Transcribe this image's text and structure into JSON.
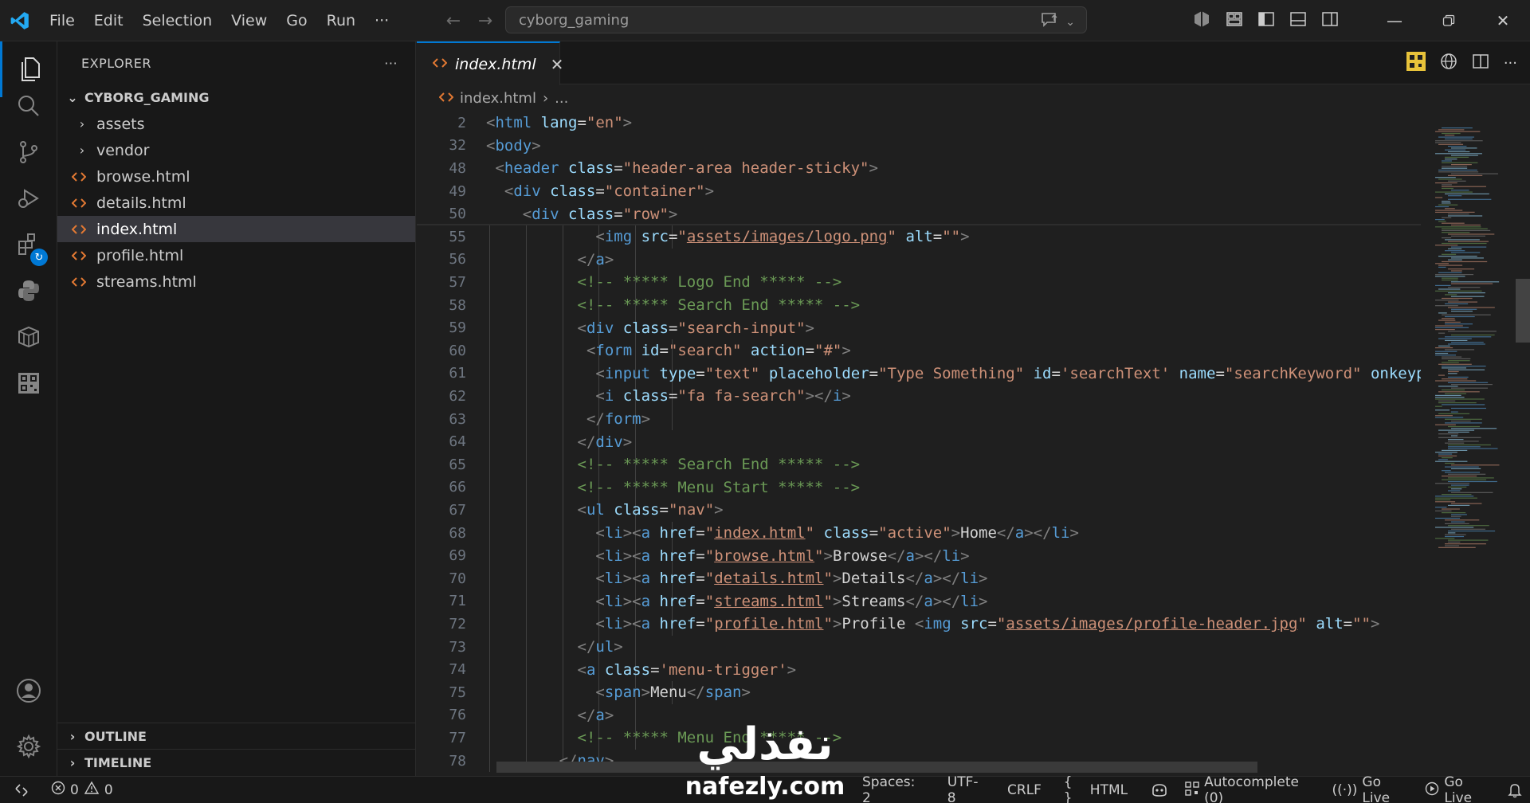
{
  "titlebar": {
    "menu": [
      "File",
      "Edit",
      "Selection",
      "View",
      "Go",
      "Run",
      "···"
    ],
    "search_text": "cyborg_gaming"
  },
  "activity_icons": [
    "explorer-icon",
    "search-icon",
    "source-control-icon",
    "run-debug-icon",
    "extensions-icon",
    "python-icon",
    "containers-icon",
    "qr-icon",
    "accounts-icon",
    "settings-gear-icon"
  ],
  "sidebar": {
    "title": "EXPLORER",
    "more": "···",
    "folder": "CYBORG_GAMING",
    "items": [
      {
        "label": "assets",
        "type": "folder"
      },
      {
        "label": "vendor",
        "type": "folder"
      },
      {
        "label": "browse.html",
        "type": "file"
      },
      {
        "label": "details.html",
        "type": "file"
      },
      {
        "label": "index.html",
        "type": "file",
        "selected": true
      },
      {
        "label": "profile.html",
        "type": "file"
      },
      {
        "label": "streams.html",
        "type": "file"
      }
    ],
    "outline": "OUTLINE",
    "timeline": "TIMELINE"
  },
  "editor": {
    "tab_label": "index.html",
    "breadcrumb_file": "index.html",
    "breadcrumb_rest": "...",
    "lines": [
      {
        "n": "2",
        "indent": 0,
        "tokens": [
          [
            "br",
            "<"
          ],
          [
            "tag",
            "html"
          ],
          [
            "txt",
            " "
          ],
          [
            "attr",
            "lang"
          ],
          [
            "txt",
            "="
          ],
          [
            "str",
            "\"en\""
          ],
          [
            "br",
            ">"
          ]
        ]
      },
      {
        "n": "32",
        "indent": 0,
        "tokens": [
          [
            "br",
            "<"
          ],
          [
            "tag",
            "body"
          ],
          [
            "br",
            ">"
          ]
        ]
      },
      {
        "n": "48",
        "indent": 1,
        "tokens": [
          [
            "br",
            "<"
          ],
          [
            "tag",
            "header"
          ],
          [
            "txt",
            " "
          ],
          [
            "attr",
            "class"
          ],
          [
            "txt",
            "="
          ],
          [
            "str",
            "\"header-area header-sticky\""
          ],
          [
            "br",
            ">"
          ]
        ]
      },
      {
        "n": "49",
        "indent": 2,
        "tokens": [
          [
            "br",
            "<"
          ],
          [
            "tag",
            "div"
          ],
          [
            "txt",
            " "
          ],
          [
            "attr",
            "class"
          ],
          [
            "txt",
            "="
          ],
          [
            "str",
            "\"container\""
          ],
          [
            "br",
            ">"
          ]
        ]
      },
      {
        "n": "50",
        "indent": 4,
        "tokens": [
          [
            "br",
            "<"
          ],
          [
            "tag",
            "div"
          ],
          [
            "txt",
            " "
          ],
          [
            "attr",
            "class"
          ],
          [
            "txt",
            "="
          ],
          [
            "str",
            "\"row\""
          ],
          [
            "br",
            ">"
          ]
        ]
      },
      {
        "n": "55",
        "indent": 12,
        "tokens": [
          [
            "br",
            "<"
          ],
          [
            "tag",
            "img"
          ],
          [
            "txt",
            " "
          ],
          [
            "attr",
            "src"
          ],
          [
            "txt",
            "="
          ],
          [
            "str",
            "\""
          ],
          [
            "link",
            "assets/images/logo.png"
          ],
          [
            "str",
            "\""
          ],
          [
            "txt",
            " "
          ],
          [
            "attr",
            "alt"
          ],
          [
            "txt",
            "="
          ],
          [
            "str",
            "\"\""
          ],
          [
            "br",
            ">"
          ]
        ]
      },
      {
        "n": "56",
        "indent": 10,
        "tokens": [
          [
            "br",
            "</"
          ],
          [
            "tag",
            "a"
          ],
          [
            "br",
            ">"
          ]
        ]
      },
      {
        "n": "57",
        "indent": 10,
        "tokens": [
          [
            "cmt",
            "<!-- ***** Logo End ***** -->"
          ]
        ]
      },
      {
        "n": "58",
        "indent": 10,
        "tokens": [
          [
            "cmt",
            "<!-- ***** Search End ***** -->"
          ]
        ]
      },
      {
        "n": "59",
        "indent": 10,
        "tokens": [
          [
            "br",
            "<"
          ],
          [
            "tag",
            "div"
          ],
          [
            "txt",
            " "
          ],
          [
            "attr",
            "class"
          ],
          [
            "txt",
            "="
          ],
          [
            "str",
            "\"search-input\""
          ],
          [
            "br",
            ">"
          ]
        ]
      },
      {
        "n": "60",
        "indent": 11,
        "tokens": [
          [
            "br",
            "<"
          ],
          [
            "tag",
            "form"
          ],
          [
            "txt",
            " "
          ],
          [
            "attr",
            "id"
          ],
          [
            "txt",
            "="
          ],
          [
            "str",
            "\"search\""
          ],
          [
            "txt",
            " "
          ],
          [
            "attr",
            "action"
          ],
          [
            "txt",
            "="
          ],
          [
            "str",
            "\"#\""
          ],
          [
            "br",
            ">"
          ]
        ]
      },
      {
        "n": "61",
        "indent": 12,
        "tokens": [
          [
            "br",
            "<"
          ],
          [
            "tag",
            "input"
          ],
          [
            "txt",
            " "
          ],
          [
            "attr",
            "type"
          ],
          [
            "txt",
            "="
          ],
          [
            "str",
            "\"text\""
          ],
          [
            "txt",
            " "
          ],
          [
            "attr",
            "placeholder"
          ],
          [
            "txt",
            "="
          ],
          [
            "str",
            "\"Type Something\""
          ],
          [
            "txt",
            " "
          ],
          [
            "attr",
            "id"
          ],
          [
            "txt",
            "="
          ],
          [
            "str",
            "'searchText'"
          ],
          [
            "txt",
            " "
          ],
          [
            "attr",
            "name"
          ],
          [
            "txt",
            "="
          ],
          [
            "str",
            "\"searchKeyword\""
          ],
          [
            "txt",
            " "
          ],
          [
            "attr",
            "onkeypress"
          ]
        ]
      },
      {
        "n": "62",
        "indent": 12,
        "tokens": [
          [
            "br",
            "<"
          ],
          [
            "tag",
            "i"
          ],
          [
            "txt",
            " "
          ],
          [
            "attr",
            "class"
          ],
          [
            "txt",
            "="
          ],
          [
            "str",
            "\"fa fa-search\""
          ],
          [
            "br",
            "></"
          ],
          [
            "tag",
            "i"
          ],
          [
            "br",
            ">"
          ]
        ]
      },
      {
        "n": "63",
        "indent": 11,
        "tokens": [
          [
            "br",
            "</"
          ],
          [
            "tag",
            "form"
          ],
          [
            "br",
            ">"
          ]
        ]
      },
      {
        "n": "64",
        "indent": 10,
        "tokens": [
          [
            "br",
            "</"
          ],
          [
            "tag",
            "div"
          ],
          [
            "br",
            ">"
          ]
        ]
      },
      {
        "n": "65",
        "indent": 10,
        "tokens": [
          [
            "cmt",
            "<!-- ***** Search End ***** -->"
          ]
        ]
      },
      {
        "n": "66",
        "indent": 10,
        "tokens": [
          [
            "cmt",
            "<!-- ***** Menu Start ***** -->"
          ]
        ]
      },
      {
        "n": "67",
        "indent": 10,
        "tokens": [
          [
            "br",
            "<"
          ],
          [
            "tag",
            "ul"
          ],
          [
            "txt",
            " "
          ],
          [
            "attr",
            "class"
          ],
          [
            "txt",
            "="
          ],
          [
            "str",
            "\"nav\""
          ],
          [
            "br",
            ">"
          ]
        ]
      },
      {
        "n": "68",
        "indent": 12,
        "tokens": [
          [
            "br",
            "<"
          ],
          [
            "tag",
            "li"
          ],
          [
            "br",
            "><"
          ],
          [
            "tag",
            "a"
          ],
          [
            "txt",
            " "
          ],
          [
            "attr",
            "href"
          ],
          [
            "txt",
            "="
          ],
          [
            "str",
            "\""
          ],
          [
            "link",
            "index.html"
          ],
          [
            "str",
            "\""
          ],
          [
            "txt",
            " "
          ],
          [
            "attr",
            "class"
          ],
          [
            "txt",
            "="
          ],
          [
            "str",
            "\"active\""
          ],
          [
            "br",
            ">"
          ],
          [
            "txt",
            "Home"
          ],
          [
            "br",
            "</"
          ],
          [
            "tag",
            "a"
          ],
          [
            "br",
            "></"
          ],
          [
            "tag",
            "li"
          ],
          [
            "br",
            ">"
          ]
        ]
      },
      {
        "n": "69",
        "indent": 12,
        "tokens": [
          [
            "br",
            "<"
          ],
          [
            "tag",
            "li"
          ],
          [
            "br",
            "><"
          ],
          [
            "tag",
            "a"
          ],
          [
            "txt",
            " "
          ],
          [
            "attr",
            "href"
          ],
          [
            "txt",
            "="
          ],
          [
            "str",
            "\""
          ],
          [
            "link",
            "browse.html"
          ],
          [
            "str",
            "\""
          ],
          [
            "br",
            ">"
          ],
          [
            "txt",
            "Browse"
          ],
          [
            "br",
            "</"
          ],
          [
            "tag",
            "a"
          ],
          [
            "br",
            "></"
          ],
          [
            "tag",
            "li"
          ],
          [
            "br",
            ">"
          ]
        ]
      },
      {
        "n": "70",
        "indent": 12,
        "tokens": [
          [
            "br",
            "<"
          ],
          [
            "tag",
            "li"
          ],
          [
            "br",
            "><"
          ],
          [
            "tag",
            "a"
          ],
          [
            "txt",
            " "
          ],
          [
            "attr",
            "href"
          ],
          [
            "txt",
            "="
          ],
          [
            "str",
            "\""
          ],
          [
            "link",
            "details.html"
          ],
          [
            "str",
            "\""
          ],
          [
            "br",
            ">"
          ],
          [
            "txt",
            "Details"
          ],
          [
            "br",
            "</"
          ],
          [
            "tag",
            "a"
          ],
          [
            "br",
            "></"
          ],
          [
            "tag",
            "li"
          ],
          [
            "br",
            ">"
          ]
        ]
      },
      {
        "n": "71",
        "indent": 12,
        "tokens": [
          [
            "br",
            "<"
          ],
          [
            "tag",
            "li"
          ],
          [
            "br",
            "><"
          ],
          [
            "tag",
            "a"
          ],
          [
            "txt",
            " "
          ],
          [
            "attr",
            "href"
          ],
          [
            "txt",
            "="
          ],
          [
            "str",
            "\""
          ],
          [
            "link",
            "streams.html"
          ],
          [
            "str",
            "\""
          ],
          [
            "br",
            ">"
          ],
          [
            "txt",
            "Streams"
          ],
          [
            "br",
            "</"
          ],
          [
            "tag",
            "a"
          ],
          [
            "br",
            "></"
          ],
          [
            "tag",
            "li"
          ],
          [
            "br",
            ">"
          ]
        ]
      },
      {
        "n": "72",
        "indent": 12,
        "tokens": [
          [
            "br",
            "<"
          ],
          [
            "tag",
            "li"
          ],
          [
            "br",
            "><"
          ],
          [
            "tag",
            "a"
          ],
          [
            "txt",
            " "
          ],
          [
            "attr",
            "href"
          ],
          [
            "txt",
            "="
          ],
          [
            "str",
            "\""
          ],
          [
            "link",
            "profile.html"
          ],
          [
            "str",
            "\""
          ],
          [
            "br",
            ">"
          ],
          [
            "txt",
            "Profile "
          ],
          [
            "br",
            "<"
          ],
          [
            "tag",
            "img"
          ],
          [
            "txt",
            " "
          ],
          [
            "attr",
            "src"
          ],
          [
            "txt",
            "="
          ],
          [
            "str",
            "\""
          ],
          [
            "link",
            "assets/images/profile-header.jpg"
          ],
          [
            "str",
            "\""
          ],
          [
            "txt",
            " "
          ],
          [
            "attr",
            "alt"
          ],
          [
            "txt",
            "="
          ],
          [
            "str",
            "\"\""
          ],
          [
            "br",
            ">"
          ]
        ]
      },
      {
        "n": "73",
        "indent": 10,
        "tokens": [
          [
            "br",
            "</"
          ],
          [
            "tag",
            "ul"
          ],
          [
            "br",
            ">"
          ]
        ]
      },
      {
        "n": "74",
        "indent": 10,
        "tokens": [
          [
            "br",
            "<"
          ],
          [
            "tag",
            "a"
          ],
          [
            "txt",
            " "
          ],
          [
            "attr",
            "class"
          ],
          [
            "txt",
            "="
          ],
          [
            "str",
            "'menu-trigger'"
          ],
          [
            "br",
            ">"
          ]
        ]
      },
      {
        "n": "75",
        "indent": 12,
        "tokens": [
          [
            "br",
            "<"
          ],
          [
            "tag",
            "span"
          ],
          [
            "br",
            ">"
          ],
          [
            "txt",
            "Menu"
          ],
          [
            "br",
            "</"
          ],
          [
            "tag",
            "span"
          ],
          [
            "br",
            ">"
          ]
        ]
      },
      {
        "n": "76",
        "indent": 10,
        "tokens": [
          [
            "br",
            "</"
          ],
          [
            "tag",
            "a"
          ],
          [
            "br",
            ">"
          ]
        ]
      },
      {
        "n": "77",
        "indent": 10,
        "tokens": [
          [
            "cmt",
            "<!-- ***** Menu End ***** -->"
          ]
        ]
      },
      {
        "n": "78",
        "indent": 8,
        "tokens": [
          [
            "br",
            "</"
          ],
          [
            "tag",
            "nav"
          ],
          [
            "br",
            ">"
          ]
        ]
      }
    ]
  },
  "statusbar": {
    "errors": "0",
    "warnings": "0",
    "spaces": "Spaces: 2",
    "encoding": "UTF-8",
    "eol": "CRLF",
    "language": "HTML",
    "autocomplete": "Autocomplete (0)",
    "golive1": "Go Live",
    "golive2": "Go Live"
  },
  "watermark": {
    "arabic": "نفذلي",
    "domain": "nafezly.com"
  },
  "colors": {
    "accent": "#0078d4",
    "tag": "#569cd6",
    "attr": "#9cdcfe",
    "string": "#ce9178",
    "comment": "#6a9955",
    "html_icon": "#e37933"
  }
}
